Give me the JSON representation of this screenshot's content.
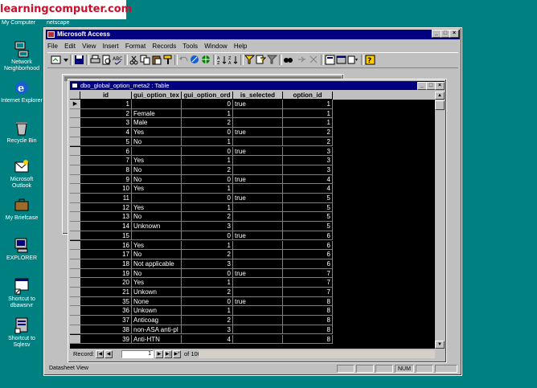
{
  "watermark": "learningcomputer.com",
  "taskbar_top": {
    "my_computer": "My Computer",
    "netscape": "netscape"
  },
  "desktop": {
    "icons": [
      {
        "label": "Network Neighborhood",
        "icon": "network-icon"
      },
      {
        "label": "Internet Explorer",
        "icon": "ie-icon"
      },
      {
        "label": "Recycle Bin",
        "icon": "recycle-bin-icon"
      },
      {
        "label": "Microsoft Outlook",
        "icon": "outlook-icon"
      },
      {
        "label": "My Briefcase",
        "icon": "briefcase-icon"
      },
      {
        "label": "EXPLORER",
        "icon": "explorer-icon"
      },
      {
        "label": "Shortcut to dbawsrvr",
        "icon": "shortcut-icon"
      },
      {
        "label": "Shortcut to Sqlesv",
        "icon": "shortcut-icon"
      }
    ]
  },
  "access": {
    "title": "Microsoft Access",
    "menu": [
      "File",
      "Edit",
      "View",
      "Insert",
      "Format",
      "Records",
      "Tools",
      "Window",
      "Help"
    ],
    "status_text": "Datasheet View",
    "status_num": "NUM"
  },
  "table_window": {
    "title": "dbo_global_option_meta2 : Table",
    "columns": [
      "id",
      "gui_option_tex",
      "gui_option_ord",
      "is_selected",
      "option_id"
    ],
    "rows": [
      [
        "1",
        "",
        "0",
        "true",
        "1"
      ],
      [
        "2",
        "Female",
        "1",
        "",
        "1"
      ],
      [
        "3",
        "Male",
        "2",
        "",
        "1"
      ],
      [
        "4",
        "Yes",
        "0",
        "true",
        "2"
      ],
      [
        "5",
        "No",
        "1",
        "",
        "2"
      ],
      [
        "6",
        "",
        "0",
        "true",
        "3"
      ],
      [
        "7",
        "Yes",
        "1",
        "",
        "3"
      ],
      [
        "8",
        "No",
        "2",
        "",
        "3"
      ],
      [
        "9",
        "No",
        "0",
        "true",
        "4"
      ],
      [
        "10",
        "Yes",
        "1",
        "",
        "4"
      ],
      [
        "11",
        "",
        "0",
        "true",
        "5"
      ],
      [
        "12",
        "Yes",
        "1",
        "",
        "5"
      ],
      [
        "13",
        "No",
        "2",
        "",
        "5"
      ],
      [
        "14",
        "Unknown",
        "3",
        "",
        "5"
      ],
      [
        "15",
        "",
        "0",
        "true",
        "6"
      ],
      [
        "16",
        "Yes",
        "1",
        "",
        "6"
      ],
      [
        "17",
        "No",
        "2",
        "",
        "6"
      ],
      [
        "18",
        "Not applicable",
        "3",
        "",
        "6"
      ],
      [
        "19",
        "No",
        "0",
        "true",
        "7"
      ],
      [
        "20",
        "Yes",
        "1",
        "",
        "7"
      ],
      [
        "21",
        "Unkown",
        "2",
        "",
        "7"
      ],
      [
        "35",
        "None",
        "0",
        "true",
        "8"
      ],
      [
        "36",
        "Unkown",
        "1",
        "",
        "8"
      ],
      [
        "37",
        "Anticoag",
        "2",
        "",
        "8"
      ],
      [
        "38",
        "non-ASA anti-pl",
        "3",
        "",
        "8"
      ],
      [
        "39",
        "Anti-HTN",
        "4",
        "",
        "8"
      ]
    ],
    "nav_label": "Record:",
    "record_value": "1",
    "record_of": "of  1007"
  },
  "colors": {
    "desktop": "#008080",
    "titlebar": "#000080",
    "grid_bg": "#000000",
    "grid_text": "#ffffff",
    "chrome": "#c0c0c0"
  }
}
